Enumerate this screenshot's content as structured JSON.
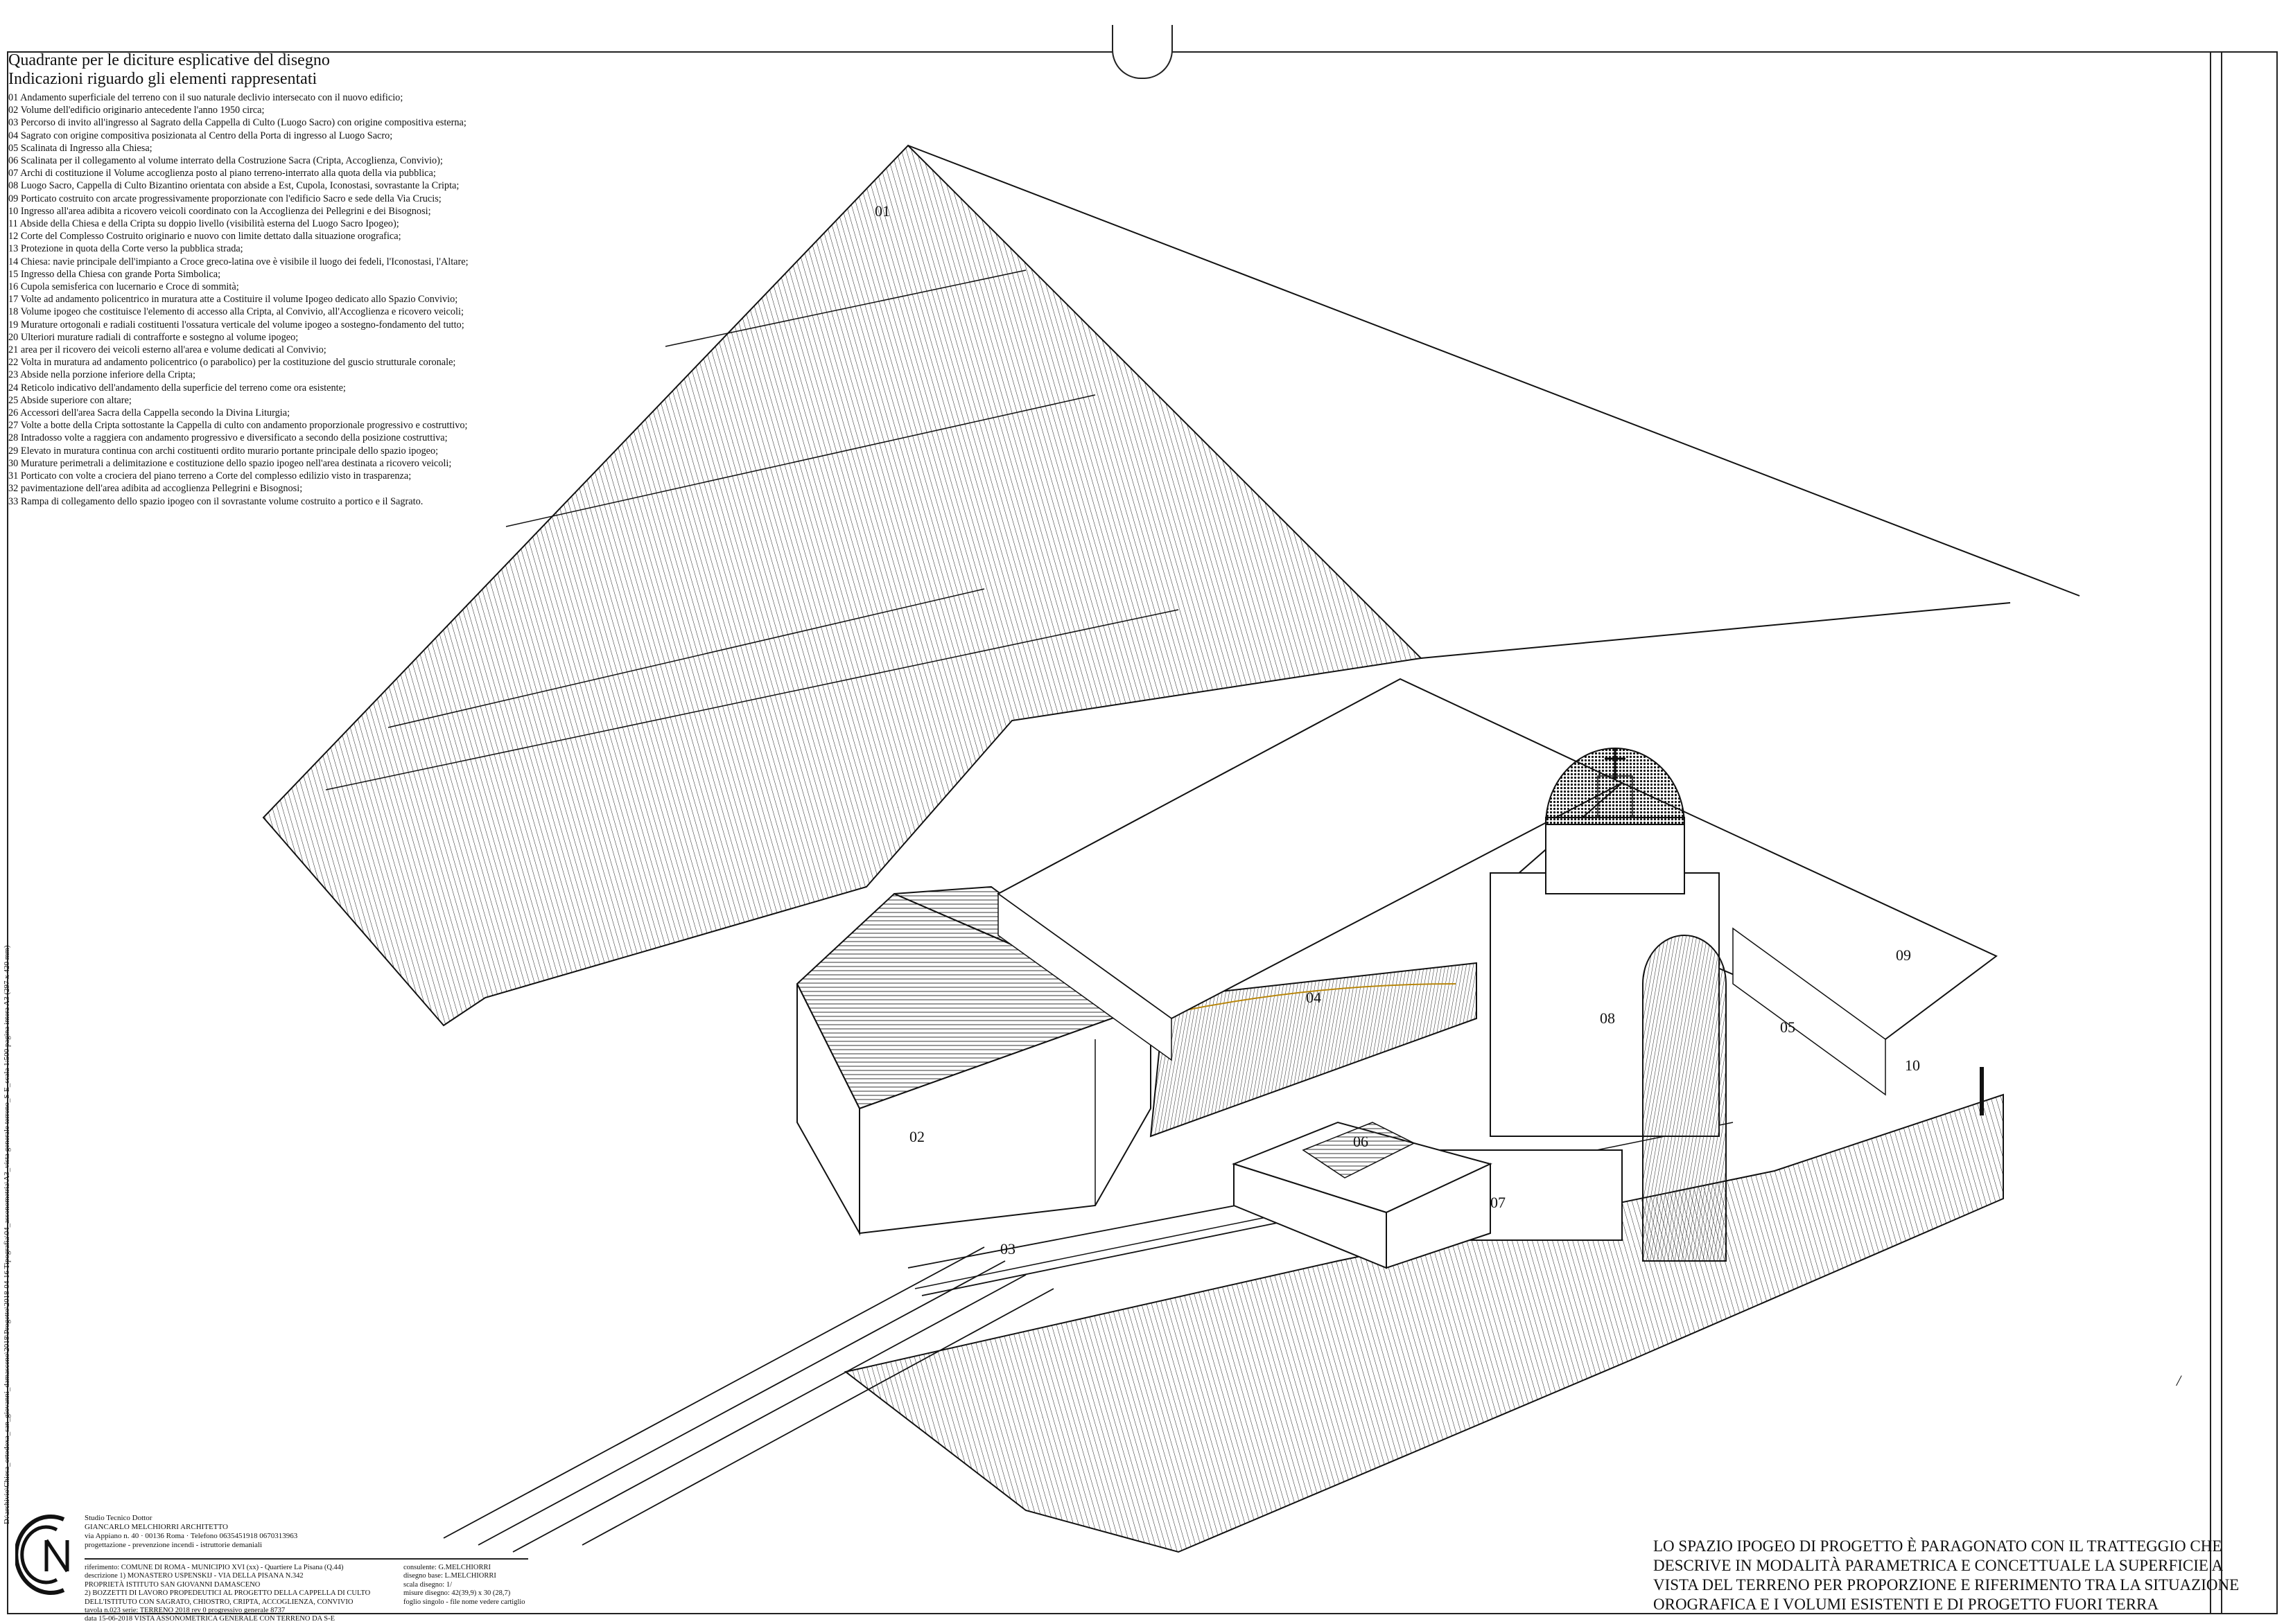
{
  "legend": {
    "title": "Quadrante per le diciture esplicative del disegno",
    "subtitle": "Indicazioni riguardo gli elementi rappresentati",
    "items": [
      "01 Andamento superficiale del terreno con il suo naturale declivio intersecato con il nuovo edificio;",
      "02 Volume dell'edificio originario antecedente l'anno 1950 circa;",
      "03 Percorso di invito all'ingresso al Sagrato della Cappella di Culto (Luogo Sacro) con origine compositiva esterna;",
      "04 Sagrato con origine compositiva posizionata al Centro della Porta di ingresso al Luogo Sacro;",
      "05 Scalinata di Ingresso alla Chiesa;",
      "06 Scalinata per il collegamento al volume interrato della Costruzione Sacra (Cripta, Accoglienza, Convivio);",
      "07 Archi di costituzione il Volume accoglienza posto al piano terreno-interrato alla quota della via pubblica;",
      "08 Luogo Sacro, Cappella di Culto Bizantino orientata con abside a Est, Cupola, Iconostasi, sovrastante la Cripta;",
      "09 Porticato costruito con arcate progressivamente proporzionate con l'edificio Sacro e sede della Via Crucis;",
      "10 Ingresso all'area adibita a ricovero veicoli coordinato con la Accoglienza dei Pellegrini e dei Bisognosi;",
      "11 Abside della Chiesa e della Cripta su doppio livello (visibilità esterna del Luogo Sacro Ipogeo);",
      "12 Corte del Complesso Costruito originario e nuovo con limite dettato dalla situazione orografica;",
      "13 Protezione in quota della Corte verso la pubblica strada;",
      "14 Chiesa: navie principale dell'impianto a Croce greco-latina ove è visibile il luogo dei fedeli, l'Iconostasi, l'Altare;",
      "15 Ingresso della Chiesa con grande Porta Simbolica;",
      "16 Cupola semisferica con lucernario e Croce di sommità;",
      "17 Volte ad andamento policentrico in muratura atte a Costituire il volume Ipogeo dedicato allo Spazio Convivio;",
      "18 Volume ipogeo che costituisce l'elemento di accesso alla Cripta, al Convivio, all'Accoglienza e ricovero veicoli;",
      "19 Murature ortogonali e radiali costituenti l'ossatura verticale del volume ipogeo a sostegno-fondamento del tutto;",
      "20 Ulteriori murature radiali di contrafforte e sostegno al volume ipogeo;",
      "21 area per il ricovero dei veicoli esterno all'area e volume dedicati al Convivio;",
      "22 Volta in muratura ad andamento policentrico (o parabolico) per la costituzione del guscio strutturale coronale;",
      "23 Abside nella porzione inferiore della Cripta;",
      "24 Reticolo indicativo dell'andamento della superficie del terreno come ora esistente;",
      "25 Abside superiore con altare;",
      "26 Accessori dell'area Sacra della Cappella secondo la Divina Liturgia;",
      "27 Volte a botte della Cripta sottostante la Cappella di culto con andamento proporzionale progressivo e costruttivo;",
      "28 Intradosso volte a raggiera con andamento progressivo e diversificato a secondo della posizione costruttiva;",
      "29 Elevato in muratura continua con archi costituenti ordito murario portante principale dello spazio ipogeo;",
      "30 Murature perimetrali a delimitazione e costituzione dello spazio ipogeo nell'area destinata a ricovero veicoli;",
      "31 Porticato con volte a crociera del piano terreno a Corte del complesso edilizio visto in trasparenza;",
      "32 pavimentazione dell'area adibita ad accoglienza Pellegrini e Bisognosi;",
      "33 Rampa di collegamento dello spazio ipogeo con il sovrastante volume costruito a portico e il Sagrato."
    ]
  },
  "callouts": {
    "c01": "01",
    "c02": "02",
    "c03": "03",
    "c04": "04",
    "c05": "05",
    "c06": "06",
    "c07": "07",
    "c08": "08",
    "c09": "09",
    "c10": "10"
  },
  "side_reference": "D:\\archivio\\Chiesa_ortodoxa_san_giovanni_damasceno\\2018\\Progetto\\2018-04-16 Tipografia\\04_assonometria\\A3_vista generale terreno_S-E_scala 1:500 pagina intera A3 (297 x 420 mm)",
  "title_block": {
    "studio_lines": [
      "Studio Tecnico Dottor",
      "GIANCARLO MELCHIORRI ARCHITETTO",
      "via Appiano n. 40 · 00136 Roma · Telefono 0635451918 0670313963",
      "progettazione          -          prevenzione incendi          -          istruttorie demaniali"
    ],
    "detail_lines": [
      "riferimento: COMUNE DI ROMA - MUNICIPIO XVI (xx) - Quartiere La Pisana (Q.44)",
      "descrizione 1) MONASTERO USPENSKIJ - VIA DELLA PISANA N.342",
      "PROPRIETÀ ISTITUTO SAN GIOVANNI DAMASCENO",
      "2) BOZZETTI DI LAVORO PROPEDEUTICI AL PROGETTO DELLA CAPPELLA DI CULTO",
      "DELL'ISTITUTO CON SAGRATO, CHIOSTRO, CRIPTA, ACCOGLIENZA, CONVIVIO",
      "tavola n.023  serie: TERRENO 2018 rev 0          progressivo generale 8737",
      "data 15-06-2018     VISTA ASSONOMETRICA GENERALE CON TERRENO DA S-E"
    ],
    "meta_lines": [
      "consulente: G.MELCHIORRI",
      "disegno base: L.MELCHIORRI",
      "scala disegno: 1/",
      "misure disegno: 42(39,9) x 30 (28,7)",
      "foglio singolo - file nome vedere cartiglio"
    ]
  },
  "note": "LO SPAZIO IPOGEO DI PROGETTO È PARAGONATO CON IL TRATTEGGIO CHE DESCRIVE IN MODALITÀ PARAMETRICA E CONCETTUALE LA SUPERFICIE A VISTA DEL TERRENO PER PROPORZIONE E RIFERIMENTO TRA LA SITUAZIONE OROGRAFICA E I VOLUMI ESISTENTI E DI PROGETTO FUORI TERRA",
  "tick_mark": "/",
  "colors": {
    "line": "#1a1a1a",
    "paper": "#ffffff",
    "accent_line": "#b8860b"
  }
}
